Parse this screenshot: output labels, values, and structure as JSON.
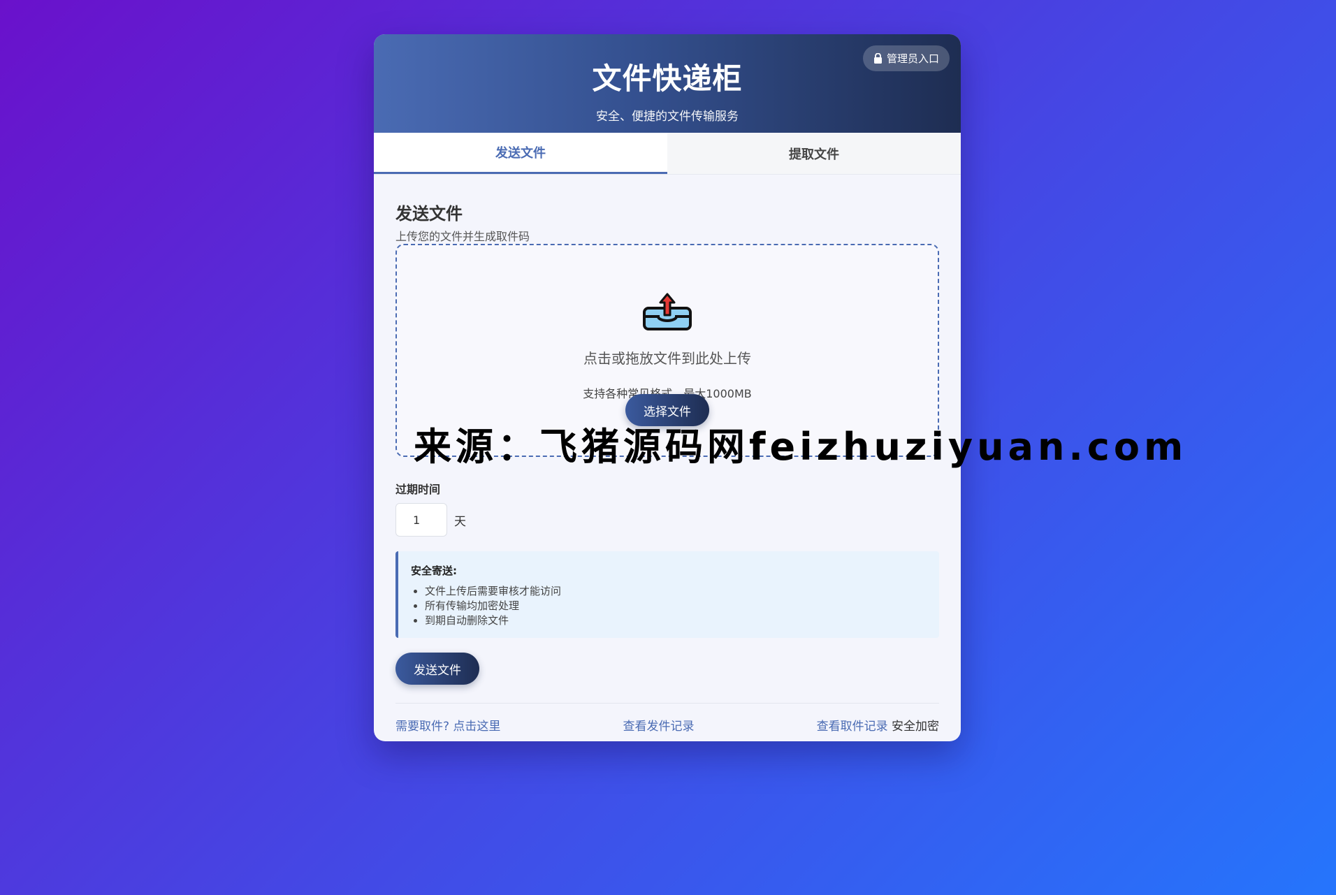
{
  "header": {
    "title": "文件快递柜",
    "subtitle": "安全、便捷的文件传输服务",
    "admin_label": "管理员入口"
  },
  "tabs": [
    {
      "label": "发送文件",
      "active": true
    },
    {
      "label": "提取文件",
      "active": false
    }
  ],
  "send": {
    "title": "发送文件",
    "desc": "上传您的文件并生成取件码",
    "drop_text": "点击或拖放文件到此处上传",
    "drop_hint": "支持各种常见格式，最大1000MB",
    "choose_label": "选择文件",
    "expiry_label": "过期时间",
    "expiry_value": "1",
    "expiry_unit": "天",
    "notice_title": "安全寄送:",
    "notice_items": [
      "文件上传后需要审核才能访问",
      "所有传输均加密处理",
      "到期自动删除文件"
    ],
    "send_label": "发送文件"
  },
  "footer": {
    "link1": "需要取件? 点击这里",
    "link2": "查看发件记录",
    "link3": "查看取件记录",
    "text": "安全加密"
  },
  "watermark": "来源：飞猪源码网feizhuziyuan.com",
  "colors": {
    "accent": "#4a6bb3",
    "header_dark": "#1e2d52"
  }
}
